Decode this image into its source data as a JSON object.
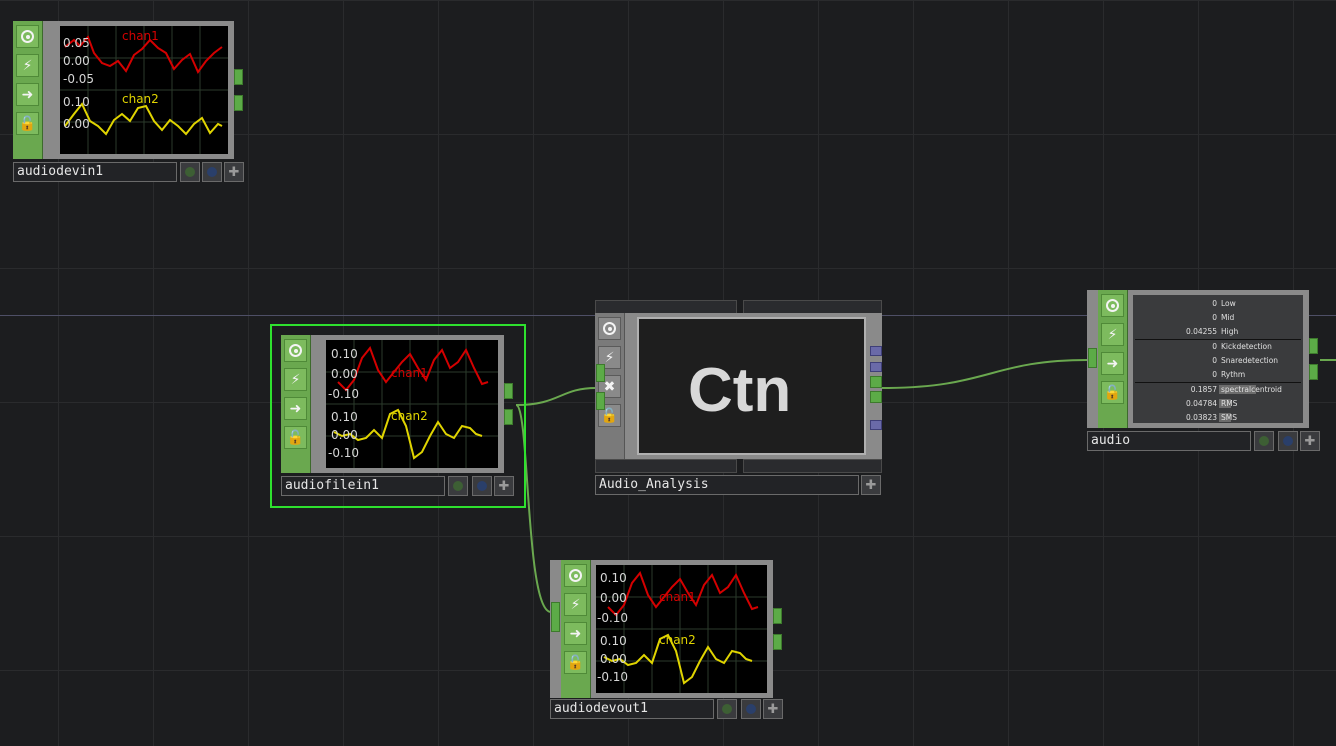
{
  "colors": {
    "background": "#1c1d1f",
    "node_green": "#6aa84f",
    "selection": "#2ee12e",
    "wire": "#6aa84f",
    "chan1": "#d40000",
    "chan2": "#e0d400",
    "port_purple": "#6a6aa8"
  },
  "icons": [
    "viewer-icon",
    "bypass-icon",
    "export-icon",
    "lock-icon",
    "clone-icon",
    "viewer-active-icon",
    "cooking-icon"
  ],
  "nodes": {
    "audiodevin1": {
      "name": "audiodevin1",
      "plot": {
        "ch1": {
          "name": "chan1",
          "ticks": [
            "0.05",
            "0.00",
            "-0.05"
          ]
        },
        "ch2": {
          "name": "chan2",
          "ticks": [
            "0.10",
            "0.00"
          ]
        }
      }
    },
    "audiofilein1": {
      "name": "audiofilein1",
      "plot": {
        "ch1": {
          "name": "chan1",
          "ticks": [
            "0.10",
            "0.00",
            "-0.10"
          ]
        },
        "ch2": {
          "name": "chan2",
          "ticks": [
            "0.10",
            "0.00",
            "-0.10"
          ]
        }
      }
    },
    "audio_analysis": {
      "name": "Audio_Analysis",
      "label": "Ctn"
    },
    "audiodevout1": {
      "name": "audiodevout1",
      "plot": {
        "ch1": {
          "name": "chan1",
          "ticks": [
            "0.10",
            "0.00",
            "-0.10"
          ]
        },
        "ch2": {
          "name": "chan2",
          "ticks": [
            "0.10",
            "0.00",
            "-0.10"
          ]
        }
      }
    },
    "audio": {
      "name": "audio",
      "rows": [
        {
          "value": "0",
          "name": "Low"
        },
        {
          "value": "0",
          "name": "Mid"
        },
        {
          "value": "0.04255",
          "name": "High"
        },
        {
          "value": "0",
          "name": "Kickdetection"
        },
        {
          "value": "0",
          "name": "Snaredetection"
        },
        {
          "value": "0",
          "name": "Rythm"
        },
        {
          "value": "0.1857",
          "name": "spectralcentroid"
        },
        {
          "value": "0.04784",
          "name": "RMS"
        },
        {
          "value": "0.03823",
          "name": "SMS"
        }
      ],
      "row_levels": [
        0,
        0,
        0.04255,
        0,
        0,
        0,
        0.1857,
        0.04784,
        0.03823
      ]
    }
  }
}
